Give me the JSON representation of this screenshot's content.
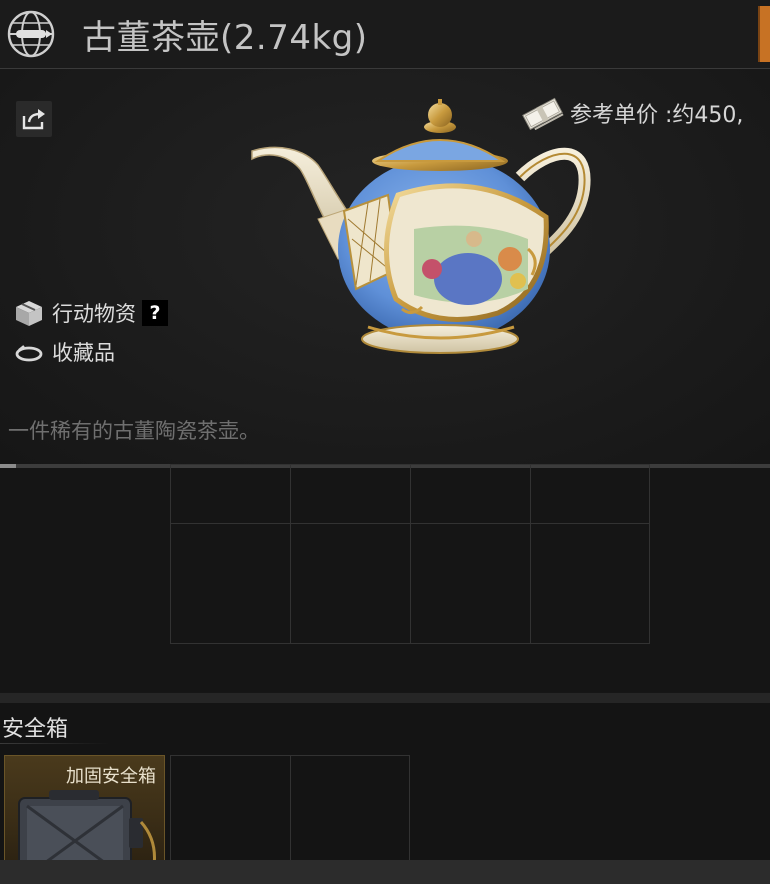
{
  "header": {
    "title": "古董茶壶(2.74kg)",
    "icon": "globe-icon"
  },
  "item": {
    "price_label": "参考单价 :约450,",
    "tags": [
      {
        "label": "行动物资",
        "icon": "box-icon",
        "help": "?"
      },
      {
        "label": "收藏品",
        "icon": "ring-icon"
      }
    ],
    "description": "一件稀有的古董陶瓷茶壶。",
    "image": "antique-teapot"
  },
  "inventory": {
    "rows": 2,
    "cols": 4
  },
  "safe_box": {
    "section_title": "安全箱",
    "equipped_name": "加固安全箱",
    "empty_slots": 2
  },
  "colors": {
    "accent_orange": "#c77224",
    "safe_slot_gold": "#4a3a1c",
    "background": "#161616"
  }
}
